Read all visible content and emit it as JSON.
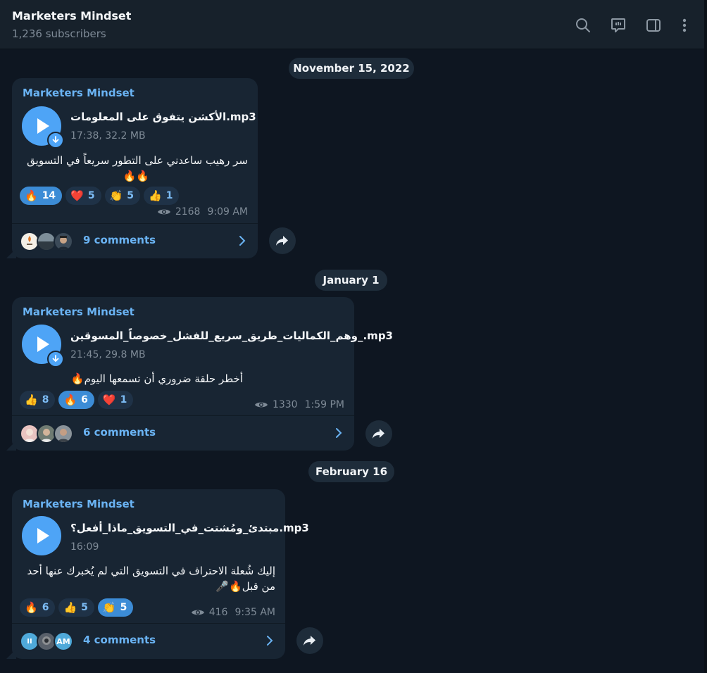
{
  "channel": {
    "title": "Marketers Mindset",
    "subscribers": "1,236 subscribers"
  },
  "header_icons": [
    "search-icon",
    "discussion-icon",
    "sidebar-toggle-icon",
    "more-options-icon"
  ],
  "dates": [
    "November 15, 2022",
    "January 1",
    "February 16"
  ],
  "posts": [
    {
      "author": "Marketers Mindset",
      "file_name": "الأكشن يتفوق على المعلومات.mp3",
      "file_meta": "17:38, 32.2 MB",
      "caption_line1": "سر رهيب ساعدني على التطور سريعاً في التسويق",
      "caption_line2": "🔥🔥",
      "reactions": [
        {
          "emoji": "🔥",
          "count": "14",
          "mine": true
        },
        {
          "emoji": "❤️",
          "count": "5",
          "mine": false
        },
        {
          "emoji": "👏",
          "count": "5",
          "mine": false
        },
        {
          "emoji": "👍",
          "count": "1",
          "mine": false
        }
      ],
      "views": "2168",
      "time": "9:09 AM",
      "comments": "9 comments"
    },
    {
      "author": "Marketers Mindset",
      "file_name": "وهم_الكماليات_طريق_سريع_للفشل_خصوصاً_المسوقين_.mp3",
      "file_meta": "21:45, 29.8 MB",
      "caption_line1": "أخطر حلقة ضروري أن تسمعها اليوم🔥",
      "reactions": [
        {
          "emoji": "👍",
          "count": "8",
          "mine": false
        },
        {
          "emoji": "🔥",
          "count": "6",
          "mine": true
        },
        {
          "emoji": "❤️",
          "count": "1",
          "mine": false
        }
      ],
      "views": "1330",
      "time": "1:59 PM",
      "comments": "6 comments"
    },
    {
      "author": "Marketers Mindset",
      "file_name": "مبتدئ_ومُشتت_في_التسويق_ماذا_أفعل؟.mp3",
      "file_meta": "16:09",
      "caption_line1": "إليك شُعلة الاحتراف في التسويق التي لم يُخبرك عنها أحد",
      "caption_line2": "من قبل🔥🎤",
      "reactions": [
        {
          "emoji": "🔥",
          "count": "6",
          "mine": false
        },
        {
          "emoji": "👍",
          "count": "5",
          "mine": false
        },
        {
          "emoji": "👏",
          "count": "5",
          "mine": true
        }
      ],
      "views": "416",
      "time": "9:35 AM",
      "comments": "4 comments",
      "avatar_texts": [
        "II",
        "AM"
      ]
    }
  ],
  "colors": {
    "background": "#0e1621",
    "bubble": "#182533",
    "accent": "#6ab3f3",
    "play": "#4ea4f6"
  }
}
